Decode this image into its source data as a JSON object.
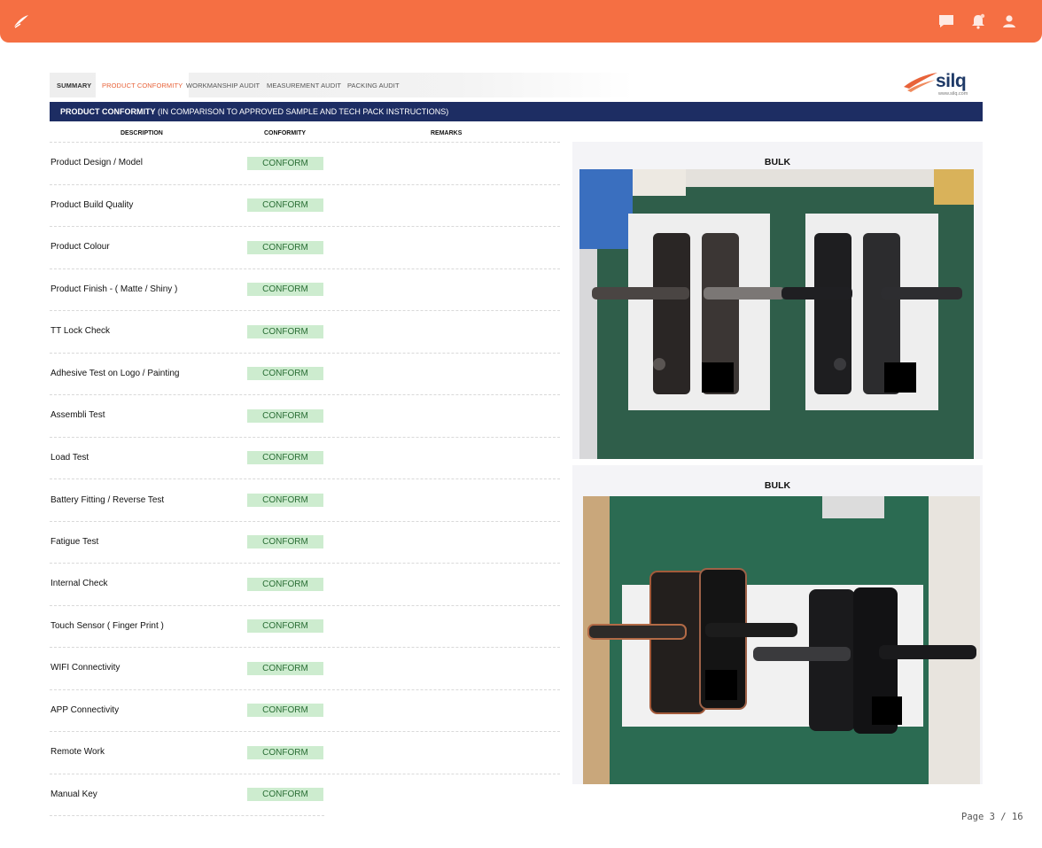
{
  "header": {
    "brand_color": "#f56f43"
  },
  "tabs": [
    {
      "label": "SUMMARY",
      "active": false
    },
    {
      "label": "PRODUCT CONFORMITY",
      "active": true
    },
    {
      "label": "WORKMANSHIP AUDIT",
      "active": false
    },
    {
      "label": "MEASUREMENT AUDIT",
      "active": false
    },
    {
      "label": "PACKING AUDIT",
      "active": false
    }
  ],
  "brand": {
    "name": "silq",
    "url": "www.silq.com"
  },
  "section": {
    "title": "PRODUCT CONFORMITY",
    "subtitle": "(IN COMPARISON TO APPROVED SAMPLE AND TECH PACK INSTRUCTIONS)"
  },
  "table": {
    "headers": {
      "description": "DESCRIPTION",
      "conformity": "CONFORMITY",
      "remarks": "REMARKS"
    },
    "rows": [
      {
        "description": "Product Design / Model",
        "conformity": "CONFORM",
        "remarks": ""
      },
      {
        "description": "Product Build Quality",
        "conformity": "CONFORM",
        "remarks": ""
      },
      {
        "description": "Product Colour",
        "conformity": "CONFORM",
        "remarks": ""
      },
      {
        "description": "Product  Finish - ( Matte / Shiny )",
        "conformity": "CONFORM",
        "remarks": ""
      },
      {
        "description": "TT Lock Check",
        "conformity": "CONFORM",
        "remarks": ""
      },
      {
        "description": "Adhesive Test on Logo / Painting",
        "conformity": "CONFORM",
        "remarks": ""
      },
      {
        "description": "Assembli Test",
        "conformity": "CONFORM",
        "remarks": ""
      },
      {
        "description": "Load Test",
        "conformity": "CONFORM",
        "remarks": ""
      },
      {
        "description": "Battery Fitting / Reverse Test",
        "conformity": "CONFORM",
        "remarks": ""
      },
      {
        "description": "Fatigue Test",
        "conformity": "CONFORM",
        "remarks": ""
      },
      {
        "description": "Internal Check",
        "conformity": "CONFORM",
        "remarks": ""
      },
      {
        "description": "Touch Sensor ( Finger Print )",
        "conformity": "CONFORM",
        "remarks": ""
      },
      {
        "description": "WIFI Connectivity",
        "conformity": "CONFORM",
        "remarks": ""
      },
      {
        "description": "APP Connectivity",
        "conformity": "CONFORM",
        "remarks": ""
      },
      {
        "description": "Remote Work",
        "conformity": "CONFORM",
        "remarks": ""
      },
      {
        "description": "Manual Key",
        "conformity": "CONFORM",
        "remarks": ""
      }
    ]
  },
  "photos": [
    {
      "label": "BULK"
    },
    {
      "label": "BULK"
    }
  ],
  "pager": {
    "text": "Page 3 / 16",
    "current": 3,
    "total": 16
  }
}
